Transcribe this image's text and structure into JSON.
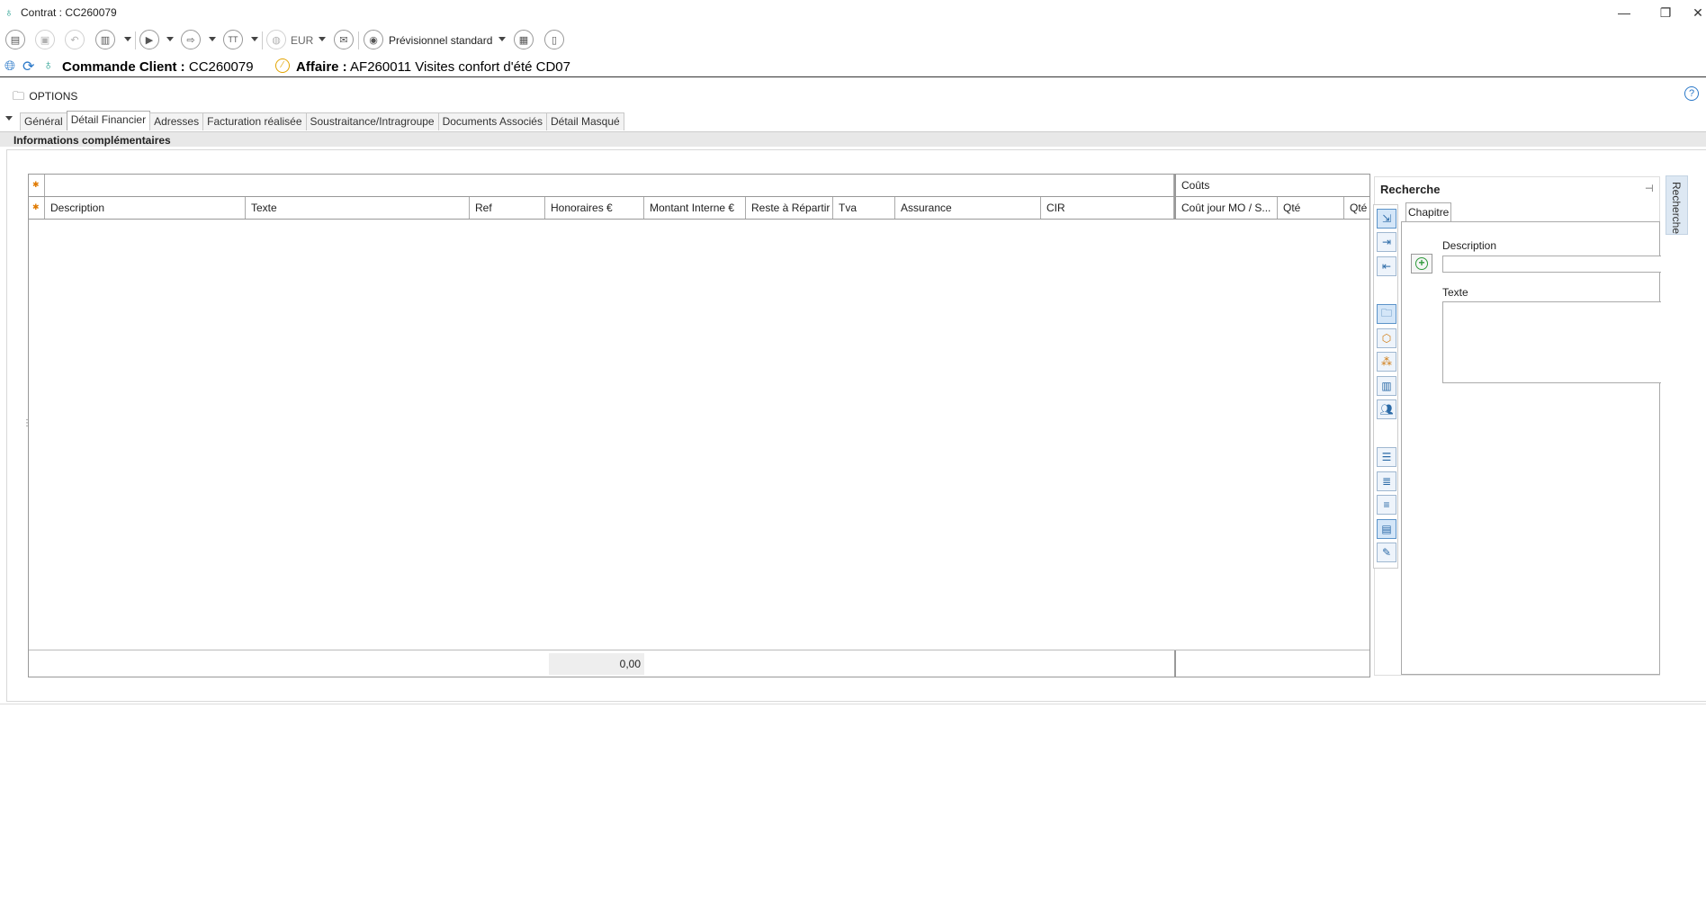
{
  "window": {
    "title": "Contrat : CC260079"
  },
  "toolbar": {
    "currency": "EUR",
    "view": "Prévisionnel standard"
  },
  "header": {
    "commande_label": "Commande Client :",
    "commande_value": "CC260079",
    "affaire_label": "Affaire :",
    "affaire_value": "AF260011 Visites confort d'été CD07"
  },
  "options": {
    "label": "OPTIONS"
  },
  "tabs": [
    "Général",
    "Détail Financier",
    "Adresses",
    "Facturation réalisée",
    "Soustraitance/Intragroupe",
    "Documents Associés",
    "Détail Masqué"
  ],
  "info_bar": "Informations complémentaires",
  "grid": {
    "group_header": "Coûts",
    "columns": [
      "Description",
      "Texte",
      "Ref",
      "Honoraires €",
      "Montant Interne €",
      "Reste à Répartir",
      "Tva",
      "Assurance",
      "CIR",
      "Coût jour MO / S...",
      "Qté",
      "Qté"
    ],
    "footer_total": "0,00"
  },
  "search": {
    "title": "Recherche",
    "tab": "Chapitre",
    "description_label": "Description",
    "texte_label": "Texte",
    "vertical_tab": "Recherche"
  }
}
